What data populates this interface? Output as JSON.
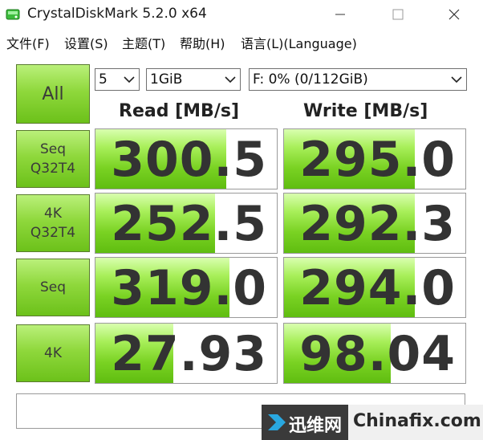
{
  "window": {
    "title": "CrystalDiskMark 5.2.0 x64"
  },
  "menu": {
    "items": [
      "文件(F)",
      "设置(S)",
      "主题(T)",
      "帮助(H)",
      "语言(L)(Language)"
    ]
  },
  "controls": {
    "all_label": "All",
    "count_value": "5",
    "size_value": "1GiB",
    "drive_value": "F: 0% (0/112GiB)"
  },
  "headers": {
    "read": "Read [MB/s]",
    "write": "Write [MB/s]"
  },
  "rows": [
    {
      "line1": "Seq",
      "line2": "Q32T4",
      "read": "300.5",
      "write": "295.0",
      "read_fill": 0.72,
      "write_fill": 0.72
    },
    {
      "line1": "4K",
      "line2": "Q32T4",
      "read": "252.5",
      "write": "292.3",
      "read_fill": 0.66,
      "write_fill": 0.72
    },
    {
      "line1": "Seq",
      "line2": "",
      "read": "319.0",
      "write": "294.0",
      "read_fill": 0.74,
      "write_fill": 0.72
    },
    {
      "line1": "4K",
      "line2": "",
      "read": "27.93",
      "write": "98.04",
      "read_fill": 0.43,
      "write_fill": 0.59
    }
  ],
  "comment": "",
  "watermark": {
    "cn": "迅维网",
    "en": "Chinafix.com"
  },
  "colors": {
    "green_light": "#baf07a",
    "green_dark": "#6cc11a",
    "bar_fill": "#7ad223"
  }
}
